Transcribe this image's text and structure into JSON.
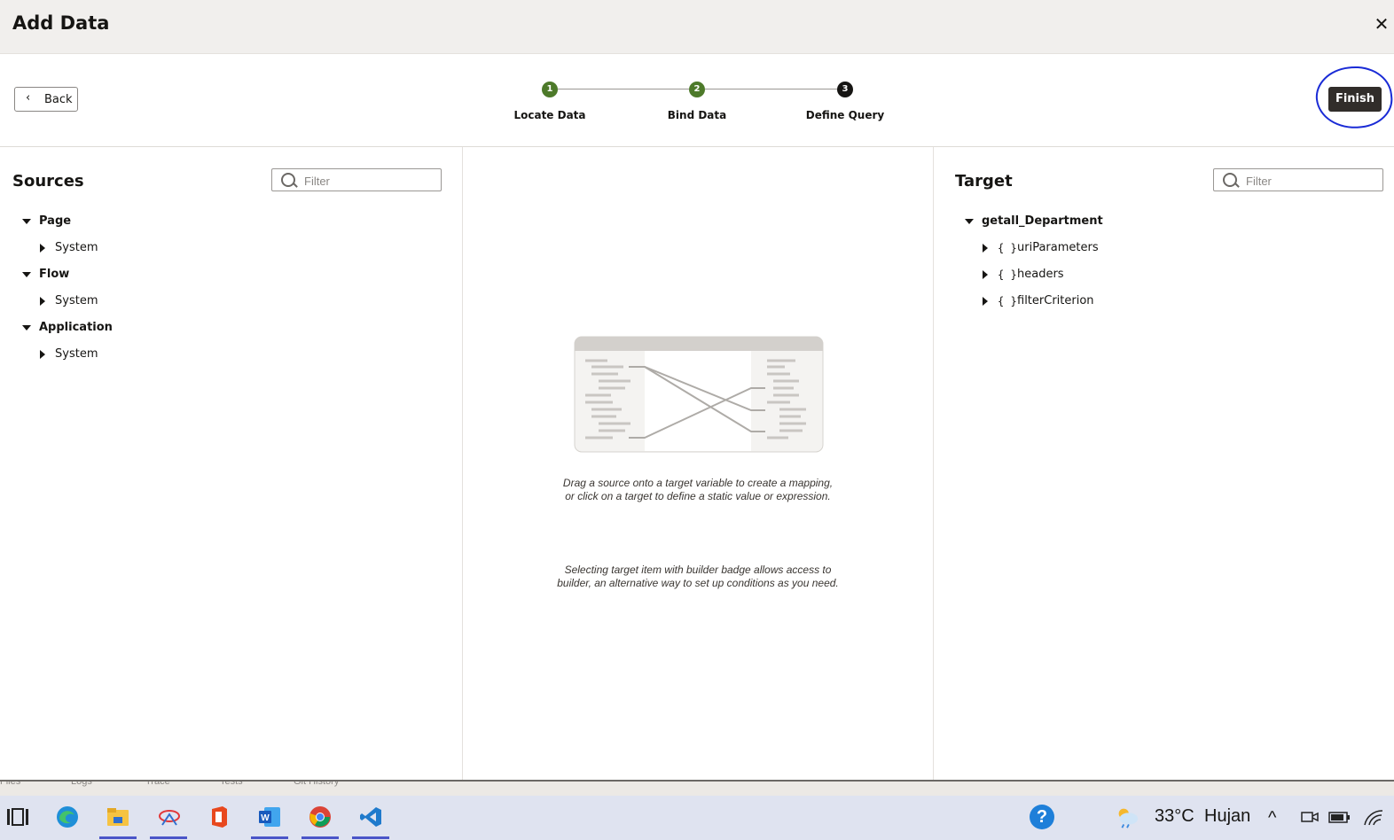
{
  "dialog": {
    "title": "Add Data",
    "close_glyph": "✕"
  },
  "toolbar": {
    "back_label": "Back",
    "finish_label": "Finish"
  },
  "steps": [
    {
      "number": "1",
      "label": "Locate Data",
      "state": "done"
    },
    {
      "number": "2",
      "label": "Bind Data",
      "state": "done"
    },
    {
      "number": "3",
      "label": "Define Query",
      "state": "current"
    }
  ],
  "sources": {
    "title": "Sources",
    "filter_placeholder": "Filter",
    "tree": [
      {
        "label": "Page",
        "child": "System"
      },
      {
        "label": "Flow",
        "child": "System"
      },
      {
        "label": "Application",
        "child": "System"
      }
    ]
  },
  "center": {
    "hint_line1": "Drag a source onto a target variable to create a mapping,",
    "hint_line2": "or click on a target to define a static value or expression.",
    "builder_line1": "Selecting target item with builder badge allows access to",
    "builder_line2": "builder, an alternative way to set up conditions as you need."
  },
  "target": {
    "title": "Target",
    "filter_placeholder": "Filter",
    "root": "getall_Department",
    "children": [
      "uriParameters",
      "headers",
      "filterCriterion"
    ],
    "brace_glyph": "{ }"
  },
  "bottom_tabs": [
    "Files",
    "Logs",
    "Trace",
    "Tests",
    "Git History"
  ],
  "taskbar": {
    "apps": [
      "task-view-icon",
      "edge-icon",
      "file-explorer-icon",
      "app-icon",
      "office-icon",
      "word-icon",
      "chrome-icon",
      "vscode-icon"
    ],
    "help_glyph": "?",
    "weather_temp": "33°C",
    "weather_text": "Hujan",
    "chevron_glyph": "^"
  },
  "colors": {
    "step_done": "#4d7a2a",
    "step_current": "#161513",
    "finish_bg": "#312d2a",
    "annotation": "#1a2bd6"
  }
}
